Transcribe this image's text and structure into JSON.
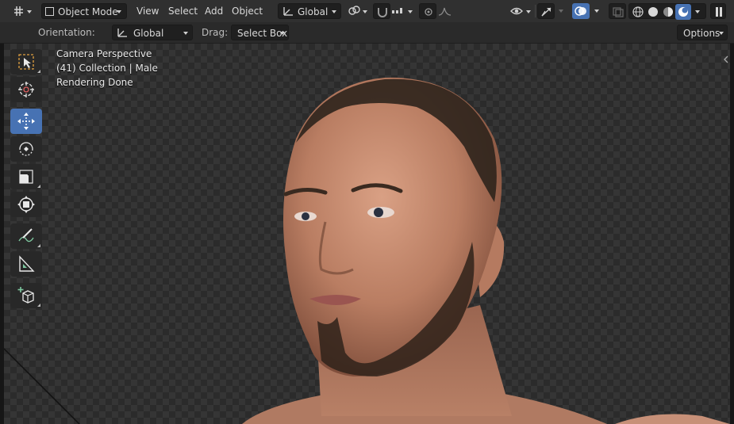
{
  "header": {
    "mode_label": "Object Mode",
    "menus": [
      "View",
      "Select",
      "Add",
      "Object"
    ],
    "transform_orientation": "Global"
  },
  "toolsettings": {
    "orientation_label": "Orientation:",
    "orientation_value": "Global",
    "drag_label": "Drag:",
    "drag_value": "Select Box",
    "options_label": "Options"
  },
  "overlay": {
    "view_name": "Camera Perspective",
    "collection_info": "(41) Collection | Male",
    "render_status": "Rendering Done"
  },
  "toolbar": {
    "tools": [
      "select-box",
      "cursor",
      "move",
      "rotate",
      "scale",
      "transform",
      "annotate",
      "measure",
      "add-cube"
    ],
    "active_tool": "move"
  },
  "colors": {
    "accent": "#4772b3",
    "header_bg": "#303030",
    "viewport_checker_a": "#2b2b2b",
    "viewport_checker_b": "#353535",
    "skin": "#c58a6e",
    "hair": "#2a2018"
  }
}
